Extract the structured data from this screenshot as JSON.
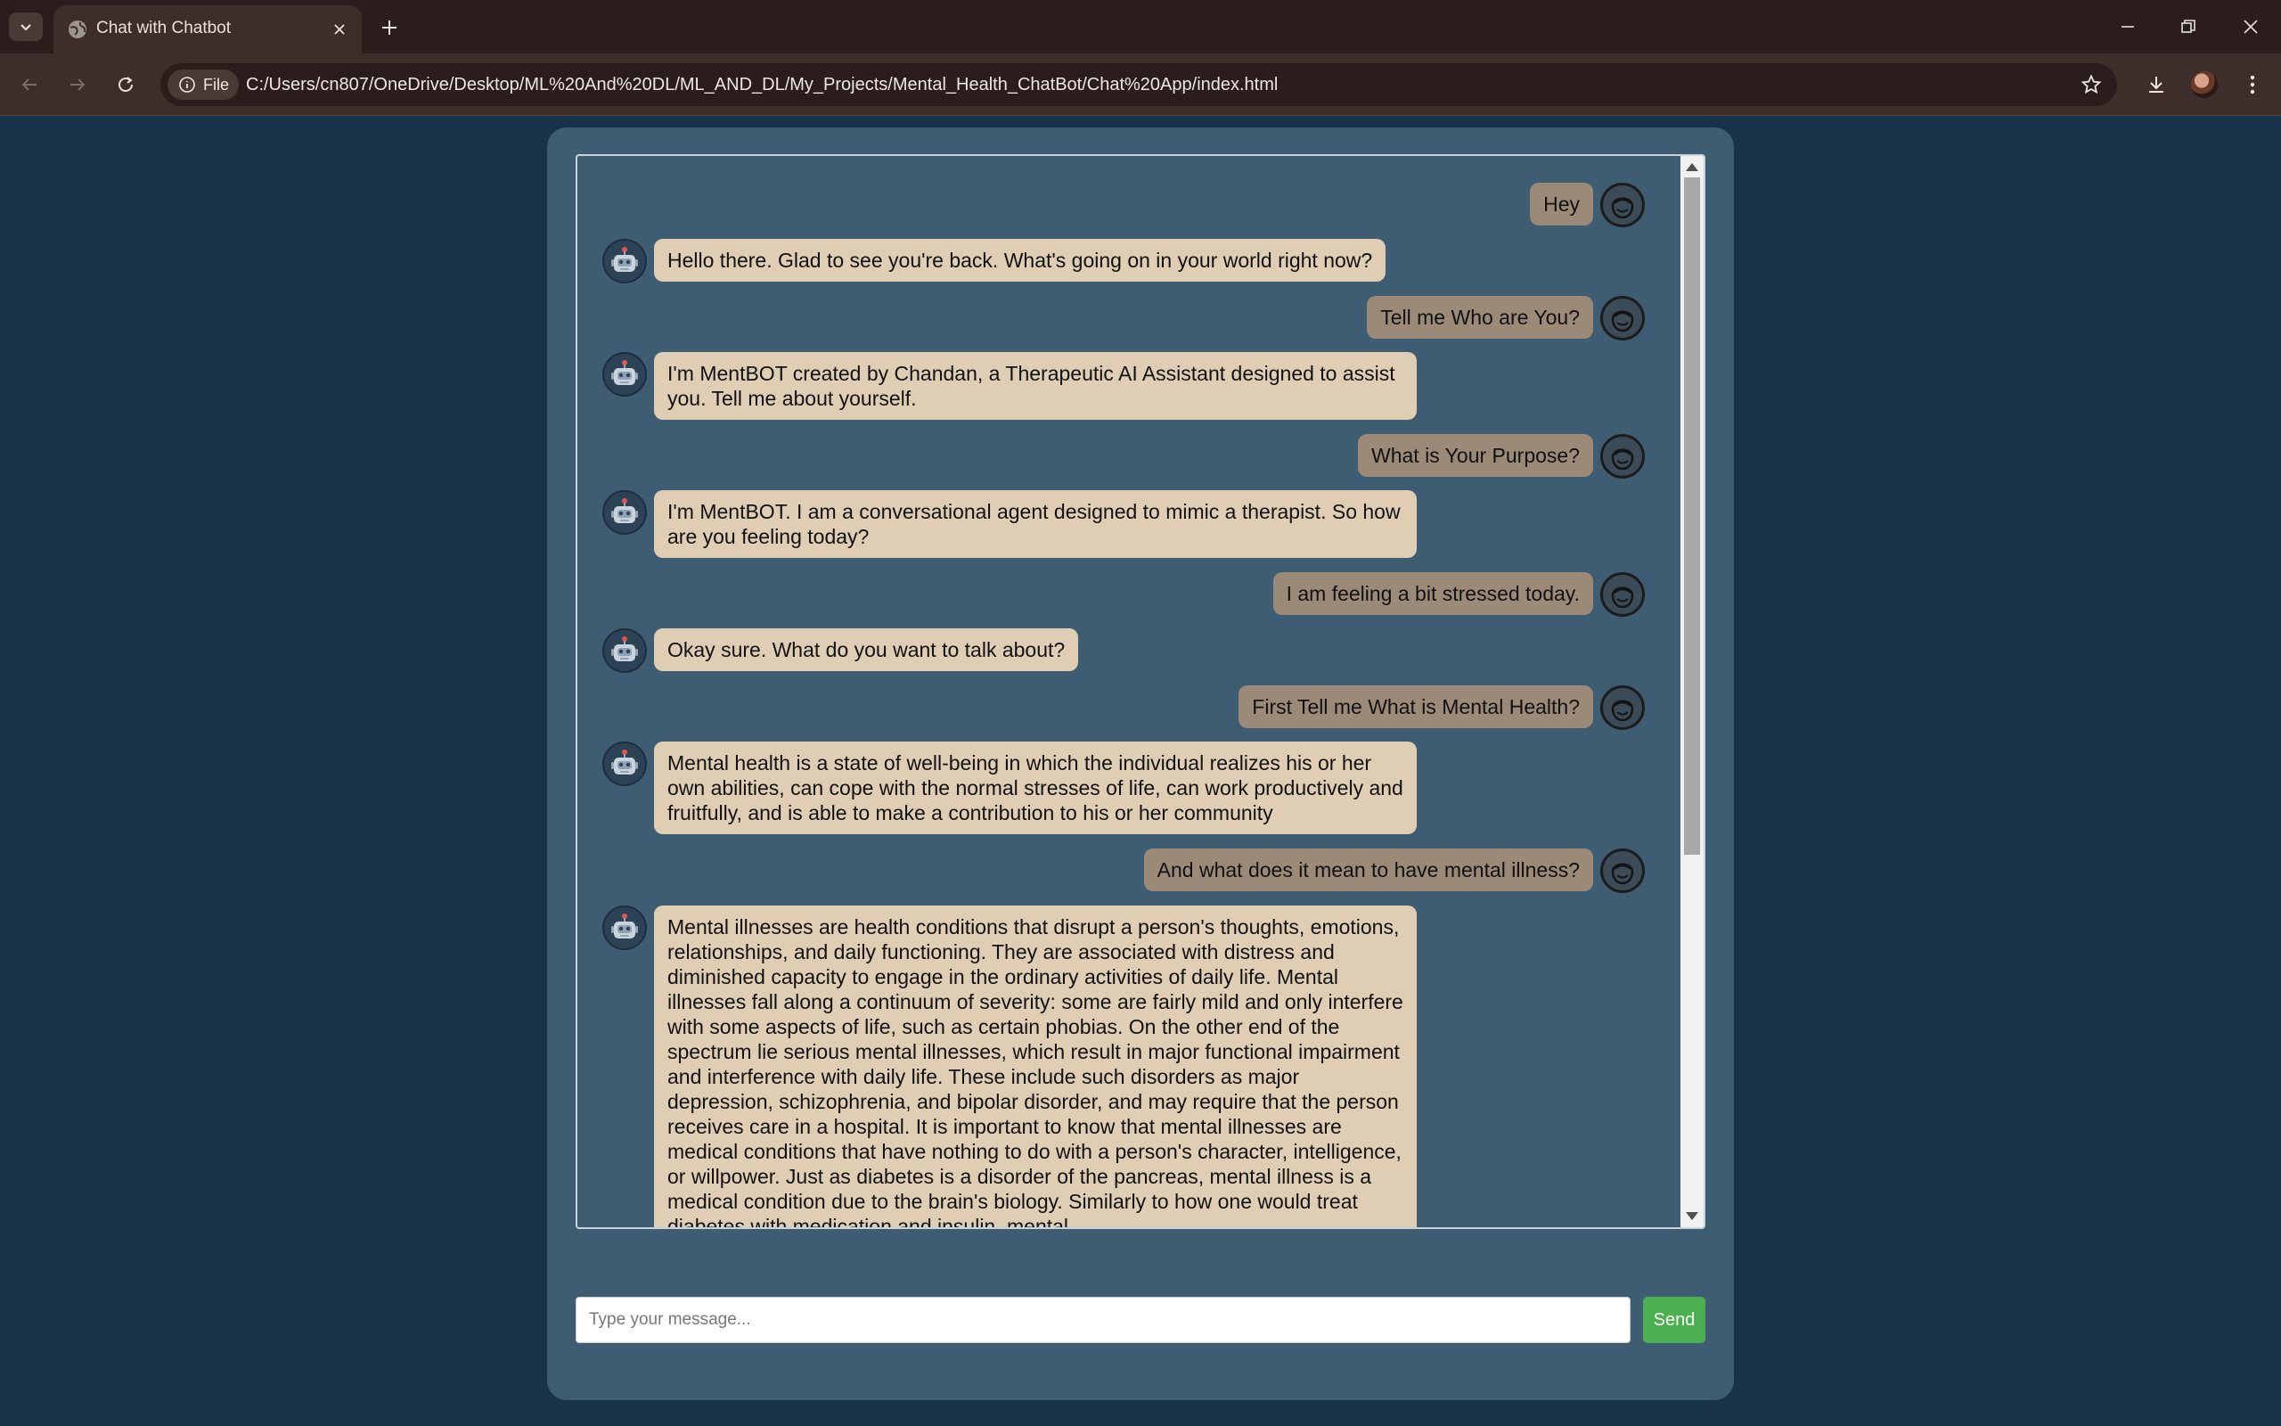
{
  "browser": {
    "tab_title": "Chat with Chatbot",
    "chip_label": "File",
    "url": "C:/Users/cn807/OneDrive/Desktop/ML%20And%20DL/ML_AND_DL/My_Projects/Mental_Health_ChatBot/Chat%20App/index.html",
    "icons": [
      "tab-list-icon",
      "globe-icon",
      "close-icon",
      "plus-icon",
      "minimize-icon",
      "restore-icon",
      "back-icon",
      "forward-icon",
      "reload-icon",
      "info-icon",
      "star-icon",
      "download-icon",
      "profile-avatar",
      "more-icon"
    ]
  },
  "chat": {
    "messages": [
      {
        "sender": "user",
        "text": "Hey"
      },
      {
        "sender": "bot",
        "text": "Hello there. Glad to see you're back. What's going on in your world right now?"
      },
      {
        "sender": "user",
        "text": "Tell me Who are You?"
      },
      {
        "sender": "bot",
        "text": "I'm MentBOT created by Chandan, a Therapeutic AI Assistant designed to assist you. Tell me about yourself."
      },
      {
        "sender": "user",
        "text": "What is Your Purpose?"
      },
      {
        "sender": "bot",
        "text": "I'm MentBOT. I am a conversational agent designed to mimic a therapist. So how are you feeling today?"
      },
      {
        "sender": "user",
        "text": "I am feeling a bit stressed today."
      },
      {
        "sender": "bot",
        "text": "Okay sure. What do you want to talk about?"
      },
      {
        "sender": "user",
        "text": "First Tell me What is Mental Health?"
      },
      {
        "sender": "bot",
        "text": "Mental health is a state of well-being in which the individual realizes his or her own abilities, can cope with the normal stresses of life, can work productively and fruitfully, and is able to make a contribution to his or her community"
      },
      {
        "sender": "user",
        "text": "And what does it mean to have mental illness?"
      },
      {
        "sender": "bot",
        "text": "Mental illnesses are health conditions that disrupt a person's thoughts, emotions, relationships, and daily functioning. They are associated with distress and diminished capacity to engage in the ordinary activities of daily life. Mental illnesses fall along a continuum of severity: some are fairly mild and only interfere with some aspects of life, such as certain phobias. On the other end of the spectrum lie serious mental illnesses, which result in major functional impairment and interference with daily life. These include such disorders as major depression, schizophrenia, and bipolar disorder, and may require that the person receives care in a hospital. It is important to know that mental illnesses are medical conditions that have nothing to do with a person's character, intelligence, or willpower. Just as diabetes is a disorder of the pancreas, mental illness is a medical condition due to the brain's biology. Similarly to how one would treat diabetes with medication and insulin, mental"
      }
    ],
    "input_placeholder": "Type your message...",
    "input_value": "",
    "send_label": "Send"
  },
  "colors": {
    "page_bg": "#18324a",
    "container_bg": "#3e5c72",
    "bot_bubble": "#dfceb4",
    "user_bubble": "#9c8a78",
    "send_button": "#4caf50"
  }
}
